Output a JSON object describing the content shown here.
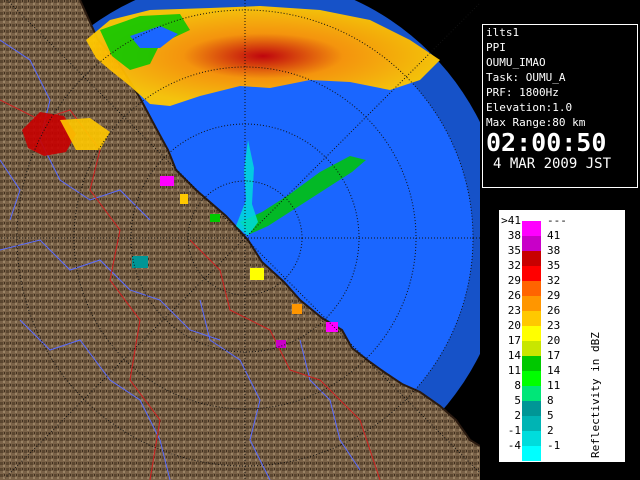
{
  "info": {
    "station": "ilts1",
    "product": "PPI",
    "volume": "OUMU_IMAO",
    "task": "Task: OUMU_A",
    "prf": "PRF: 1800Hz",
    "elevation": "Elevation:1.0",
    "max_range": "Max Range:80 km",
    "time": "02:00:50",
    "date": "4 MAR 2009 JST"
  },
  "legend": {
    "unit_label": "Reflectivity in dBZ",
    "rows": [
      {
        "low": ">41",
        "high": "---",
        "color": "#ff00ff"
      },
      {
        "low": "38",
        "high": "41",
        "color": "#c800c8"
      },
      {
        "low": "35",
        "high": "38",
        "color": "#c80000"
      },
      {
        "low": "32",
        "high": "35",
        "color": "#ff0000"
      },
      {
        "low": "29",
        "high": "32",
        "color": "#ff6400"
      },
      {
        "low": "26",
        "high": "29",
        "color": "#ff9600"
      },
      {
        "low": "23",
        "high": "26",
        "color": "#ffc800"
      },
      {
        "low": "20",
        "high": "23",
        "color": "#ffff00"
      },
      {
        "low": "17",
        "high": "20",
        "color": "#c8e600"
      },
      {
        "low": "14",
        "high": "17",
        "color": "#00c800"
      },
      {
        "low": "11",
        "high": "14",
        "color": "#00ff00"
      },
      {
        "low": "8",
        "high": "11",
        "color": "#00e678"
      },
      {
        "low": "5",
        "high": "8",
        "color": "#009696"
      },
      {
        "low": "2",
        "high": "5",
        "color": "#00b4b4"
      },
      {
        "low": "-1",
        "high": "2",
        "color": "#00dcdc"
      },
      {
        "low": "-4",
        "high": "-1",
        "color": "#00ffff"
      }
    ]
  },
  "colors": {
    "sea": "#1a66ff",
    "coverage_outer": "#1652c8",
    "land": "#7a6248",
    "background": "#000000"
  }
}
